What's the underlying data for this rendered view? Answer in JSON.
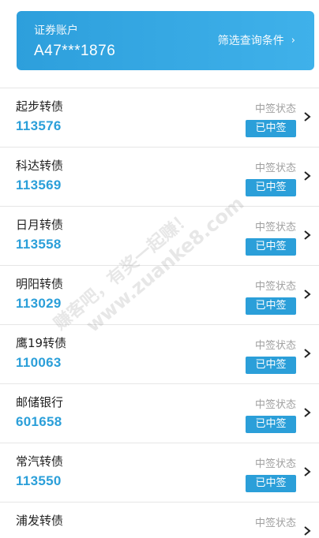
{
  "account": {
    "label": "证券账户",
    "number": "A47***1876",
    "filter_label": "筛选查询条件",
    "filter_chevron": "›"
  },
  "list": {
    "items": [
      {
        "name": "起步转债",
        "code": "113576",
        "status_label": "中签状态",
        "badge": "已中签"
      },
      {
        "name": "科达转债",
        "code": "113569",
        "status_label": "中签状态",
        "badge": "已中签"
      },
      {
        "name": "日月转债",
        "code": "113558",
        "status_label": "中签状态",
        "badge": "已中签"
      },
      {
        "name": "明阳转债",
        "code": "113029",
        "status_label": "中签状态",
        "badge": "已中签"
      },
      {
        "name": "鹰19转债",
        "code": "110063",
        "status_label": "中签状态",
        "badge": "已中签"
      },
      {
        "name": "邮储银行",
        "code": "601658",
        "status_label": "中签状态",
        "badge": "已中签"
      },
      {
        "name": "常汽转债",
        "code": "113550",
        "status_label": "中签状态",
        "badge": "已中签"
      },
      {
        "name": "浦发转债",
        "code": "",
        "status_label": "中签状态",
        "badge": ""
      }
    ]
  },
  "watermark": {
    "line1": "赚客吧，有奖一起赚！",
    "line2": "www.zuanke8.com"
  },
  "colors": {
    "accent": "#2b9fd9",
    "card_gradient_start": "#2d9fdc",
    "card_gradient_end": "#3fb1ea"
  },
  "icons": {
    "row_chevron": "chevron-right-icon",
    "filter_chevron": "chevron-right-icon"
  }
}
